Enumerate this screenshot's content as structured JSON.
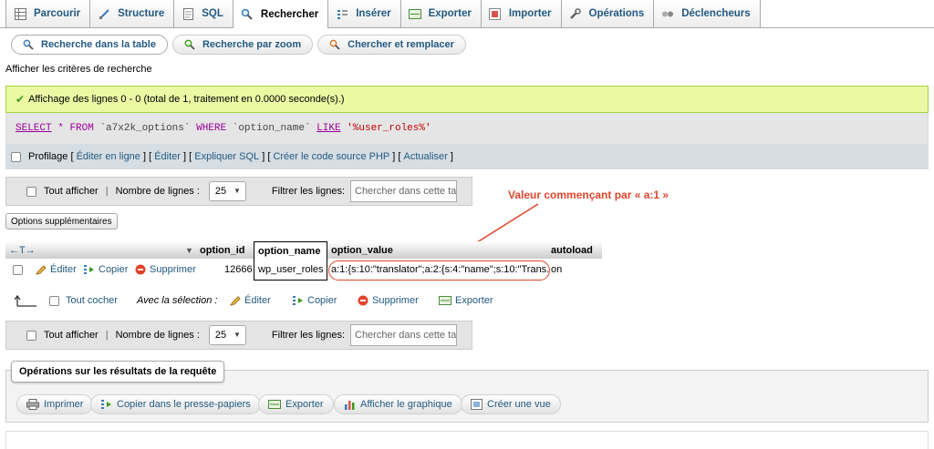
{
  "tabs": [
    {
      "label": "Parcourir",
      "icon": "browse-icon"
    },
    {
      "label": "Structure",
      "icon": "structure-icon"
    },
    {
      "label": "SQL",
      "icon": "sql-icon"
    },
    {
      "label": "Rechercher",
      "icon": "search-icon",
      "active": true
    },
    {
      "label": "Insérer",
      "icon": "insert-icon"
    },
    {
      "label": "Exporter",
      "icon": "export-icon"
    },
    {
      "label": "Importer",
      "icon": "import-icon"
    },
    {
      "label": "Opérations",
      "icon": "wrench-icon"
    },
    {
      "label": "Déclencheurs",
      "icon": "triggers-icon"
    }
  ],
  "subtabs": [
    {
      "label": "Recherche dans la table"
    },
    {
      "label": "Recherche par zoom"
    },
    {
      "label": "Chercher et remplacer"
    }
  ],
  "criteria_link": "Afficher les critères de recherche",
  "success": "Affichage des lignes 0 - 0 (total de 1, traitement en 0.0000 seconde(s).)",
  "sql": {
    "select": "SELECT",
    "star": "*",
    "from": "FROM",
    "table": "`a7x2k_options`",
    "where": "WHERE",
    "column": "`option_name`",
    "like": "LIKE",
    "pattern": "'%user_roles%'"
  },
  "profiling": {
    "label": "Profilage",
    "links": [
      "Éditer en ligne",
      "Éditer",
      "Expliquer SQL",
      "Créer le code source PHP",
      "Actualiser"
    ]
  },
  "nav": {
    "show_all": "Tout afficher",
    "rows_label": "Nombre de lignes :",
    "rows_value": "25",
    "filter_label": "Filtrer les lignes:",
    "filter_placeholder": "Chercher dans cette table"
  },
  "extra_options": "Options supplémentaires",
  "table": {
    "columns": [
      "option_id",
      "option_name",
      "option_value",
      "autoload"
    ],
    "row": {
      "edit": "Éditer",
      "copy": "Copier",
      "delete": "Supprimer",
      "option_id": "12666",
      "option_name": "wp_user_roles",
      "option_value": "a:1:{s:10:\"translator\";a:2:{s:4:\"name\";s:10:\"Trans...",
      "autoload": "on"
    }
  },
  "annotation": "Valeur commençant par « a:1 »",
  "selection": {
    "check_all": "Tout cocher",
    "with_selection": "Avec la sélection :",
    "edit": "Éditer",
    "copy": "Copier",
    "delete": "Supprimer",
    "export": "Exporter"
  },
  "operations": {
    "title": "Opérations sur les résultats de la requête",
    "buttons": [
      "Imprimer",
      "Copier dans le presse-papiers",
      "Exporter",
      "Afficher le graphique",
      "Créer une vue"
    ]
  },
  "colors": {
    "accent": "#235a81",
    "success_bg": "#ebf8a4",
    "annotation": "#e0452b"
  }
}
